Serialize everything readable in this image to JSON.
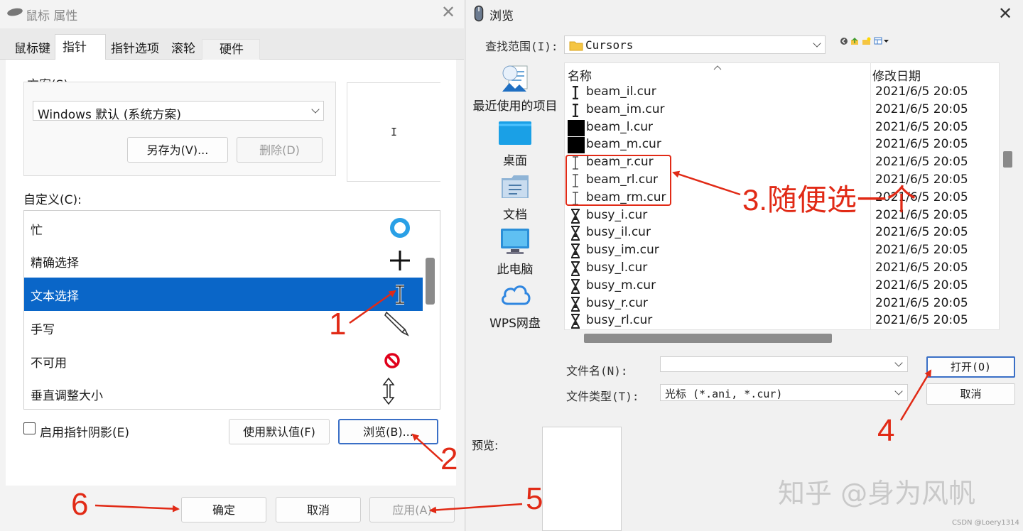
{
  "mouse_props": {
    "title": "鼠标 属性",
    "close": "✕",
    "tabs": [
      "鼠标键",
      "指针",
      "指针选项",
      "滚轮",
      "硬件"
    ],
    "scheme_label": "方案(S)",
    "scheme_value": "Windows 默认 (系统方案)",
    "save_as": "另存为(V)...",
    "delete": "删除(D)",
    "preview_glyph": "I",
    "customize_label": "自定义(C):",
    "cursors": [
      {
        "name": "忙",
        "icon": "busy-icon"
      },
      {
        "name": "精确选择",
        "icon": "crosshair-icon"
      },
      {
        "name": "文本选择",
        "icon": "ibeam-icon",
        "selected": true
      },
      {
        "name": "手写",
        "icon": "pen-icon"
      },
      {
        "name": "不可用",
        "icon": "unavailable-icon"
      },
      {
        "name": "垂直调整大小",
        "icon": "vertical-resize-icon"
      }
    ],
    "shadow_label": "启用指针阴影(E)",
    "use_default": "使用默认值(F)",
    "browse": "浏览(B)...",
    "ok": "确定",
    "cancel": "取消",
    "apply": "应用(A)"
  },
  "browse": {
    "title": "浏览",
    "close": "✕",
    "lookin_label": "查找范围(I):",
    "lookin_value": "Cursors",
    "col_name": "名称",
    "col_date": "修改日期",
    "places": [
      "最近使用的项目",
      "桌面",
      "文档",
      "此电脑",
      "WPS网盘"
    ],
    "files": [
      {
        "name": "beam_il.cur",
        "date": "2021/6/5 20:05",
        "icon": "ibeam-dark-icon"
      },
      {
        "name": "beam_im.cur",
        "date": "2021/6/5 20:05",
        "icon": "ibeam-dark-icon"
      },
      {
        "name": "beam_l.cur",
        "date": "2021/6/5 20:05",
        "icon": "black-block-icon"
      },
      {
        "name": "beam_m.cur",
        "date": "2021/6/5 20:05",
        "icon": "black-block-icon"
      },
      {
        "name": "beam_r.cur",
        "date": "2021/6/5 20:05",
        "icon": "ibeam-icon"
      },
      {
        "name": "beam_rl.cur",
        "date": "2021/6/5 20:05",
        "icon": "ibeam-icon"
      },
      {
        "name": "beam_rm.cur",
        "date": "2021/6/5 20:05",
        "icon": "ibeam-icon"
      },
      {
        "name": "busy_i.cur",
        "date": "2021/6/5 20:05",
        "icon": "hourglass-icon"
      },
      {
        "name": "busy_il.cur",
        "date": "2021/6/5 20:05",
        "icon": "hourglass-icon"
      },
      {
        "name": "busy_im.cur",
        "date": "2021/6/5 20:05",
        "icon": "hourglass-icon"
      },
      {
        "name": "busy_l.cur",
        "date": "2021/6/5 20:05",
        "icon": "hourglass-icon"
      },
      {
        "name": "busy_m.cur",
        "date": "2021/6/5 20:05",
        "icon": "hourglass-icon"
      },
      {
        "name": "busy_r.cur",
        "date": "2021/6/5 20:05",
        "icon": "hourglass-icon"
      },
      {
        "name": "busy_rl.cur",
        "date": "2021/6/5 20:05",
        "icon": "hourglass-icon"
      }
    ],
    "filename_label": "文件名(N):",
    "filename_value": "",
    "filetype_label": "文件类型(T):",
    "filetype_value": "光标 (*.ani, *.cur)",
    "open": "打开(O)",
    "cancel": "取消",
    "preview_label": "预览:"
  },
  "annotations": {
    "n1": "1",
    "n2": "2",
    "n3": "3.随便选一个",
    "n4": "4",
    "n5": "5",
    "n6": "6",
    "color": "#e12a16"
  },
  "watermark": {
    "zhihu": "知乎 @身为风帆",
    "csdn": "CSDN @Loery1314"
  }
}
